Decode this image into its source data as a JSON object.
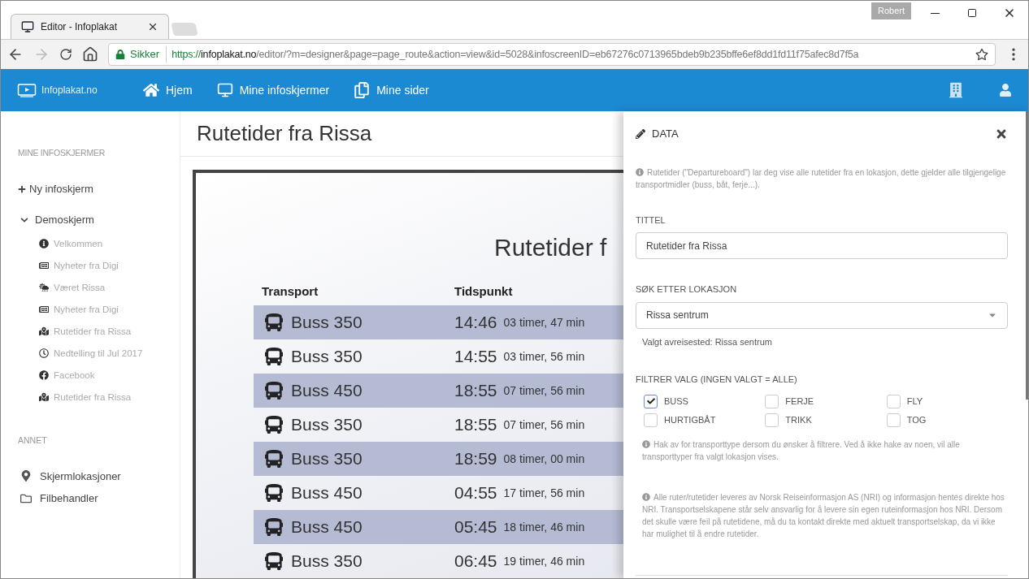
{
  "browser": {
    "tab_title": "Editor - Infoplakat",
    "profile": "Robert",
    "secure_label": "Sikker",
    "url_scheme": "https://",
    "url_host": "infoplakat.no",
    "url_path": "/editor/?m=designer&page=page_route&action=view&id=5028&infoscreenID=eb67276c0713965bdeb9b235bffe6ef8dd1fd11f75afec8d7f5a"
  },
  "navbar": {
    "logo": "Infoplakat.no",
    "items": [
      {
        "label": "Hjem",
        "kind": "home"
      },
      {
        "label": "Mine infoskjermer",
        "kind": "monitor"
      },
      {
        "label": "Mine sider",
        "kind": "pages"
      }
    ]
  },
  "sidebar": {
    "section_1": "MINE INFOSKJERMER",
    "new_screen": "Ny infoskjerm",
    "screens": [
      {
        "label": "Demoskjerm",
        "expanded": true,
        "children": [
          {
            "label": "Velkommen",
            "kind": "info"
          },
          {
            "label": "Nyheter fra Digi",
            "kind": "news"
          },
          {
            "label": "Været Rissa",
            "kind": "weather"
          },
          {
            "label": "Nyheter fra Digi",
            "kind": "news"
          },
          {
            "label": "Rutetider fra Rissa",
            "kind": "route"
          },
          {
            "label": "Nedtelling til Jul 2017",
            "kind": "clock"
          },
          {
            "label": "Facebook",
            "kind": "facebook"
          },
          {
            "label": "Rutetider fra Rissa",
            "kind": "route"
          }
        ]
      }
    ],
    "section_2": "ANNET",
    "other": [
      {
        "label": "Skjermlokasjoner",
        "kind": "pin"
      },
      {
        "label": "Filbehandler",
        "kind": "folder"
      }
    ]
  },
  "page_title": "Rutetider fra Rissa",
  "preview": {
    "title": "Rutetider f",
    "columns": [
      "Transport",
      "Tidspunkt"
    ],
    "rows": [
      {
        "transport": "Buss 350",
        "time": "14:46",
        "countdown": "03 timer, 47 min"
      },
      {
        "transport": "Buss 350",
        "time": "14:55",
        "countdown": "03 timer, 56 min"
      },
      {
        "transport": "Buss 450",
        "time": "18:55",
        "countdown": "07 timer, 56 min"
      },
      {
        "transport": "Buss 350",
        "time": "18:55",
        "countdown": "07 timer, 56 min"
      },
      {
        "transport": "Buss 350",
        "time": "18:59",
        "countdown": "08 timer, 00 min"
      },
      {
        "transport": "Buss 450",
        "time": "04:55",
        "countdown": "17 timer, 56 min"
      },
      {
        "transport": "Buss 450",
        "time": "05:45",
        "countdown": "18 timer, 46 min"
      },
      {
        "transport": "Buss 350",
        "time": "06:45",
        "countdown": "19 timer, 46 min"
      }
    ]
  },
  "panel": {
    "title": "DATA",
    "intro": "Rutetider (\"Departureboard\") lar deg vise alle rutetider fra en lokasjon, dette gjelder alle tilgjengelige transportmidler (buss, båt, ferje...).",
    "title_label": "TITTEL",
    "title_value": "Rutetider fra Rissa",
    "location_label": "SØK ETTER LOKASJON",
    "location_value": "Rissa sentrum",
    "location_selected": "Valgt avreisested: Rissa sentrum",
    "filter_label": "FILTRER VALG (INGEN VALGT = ALLE)",
    "filters": [
      {
        "label": "BUSS",
        "checked": true
      },
      {
        "label": "FERJE",
        "checked": false
      },
      {
        "label": "FLY",
        "checked": false
      },
      {
        "label": "HURTIGBÅT",
        "checked": false
      },
      {
        "label": "TRIKK",
        "checked": false
      },
      {
        "label": "TOG",
        "checked": false
      }
    ],
    "filter_hint": "Hak av for transporttype dersom du ønsker å filtrere. Ved å ikke hake av noen, vil alle transporttyper fra valgt lokasjon vises.",
    "disclaimer": "Alle ruter/rutetider leveres av Norsk Reiseinformasjon AS (NRI) og informasjon hentes direkte hos NRI. Transportselskapene står selv ansvarlig for å levere sin egen ruteinformasjon hos NRI. Dersom det skulle være feil på rutetidene, må du ta kontakt direkte med aktuelt transportselskap, da vi ikke har mulighet til å endre rutetider."
  }
}
